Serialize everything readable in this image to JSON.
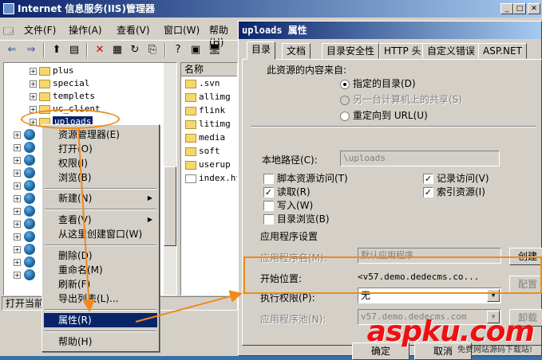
{
  "iis": {
    "title": "Internet 信息服务(IIS)管理器",
    "menu": [
      "文件(F)",
      "操作(A)",
      "查看(V)",
      "窗口(W)",
      "帮助(H)"
    ],
    "status": "打开当前"
  },
  "tree": {
    "folders": [
      "plus",
      "special",
      "templets",
      "uc_client",
      "uploads"
    ]
  },
  "list": {
    "header": "名称",
    "items": [
      ".svn",
      "allimg",
      "flink",
      "litimg",
      "media",
      "soft",
      "userup",
      "index.ht"
    ]
  },
  "context_menu": {
    "items": [
      {
        "label": "资源管理器(E)"
      },
      {
        "label": "打开(O)"
      },
      {
        "label": "权限(I)"
      },
      {
        "label": "浏览(B)"
      },
      {
        "label": "新建(N)"
      },
      {
        "label": "查看(V)"
      },
      {
        "label": "从这里创建窗口(W)"
      },
      {
        "label": "删除(D)"
      },
      {
        "label": "重命名(M)"
      },
      {
        "label": "刷新(F)"
      },
      {
        "label": "导出列表(L)..."
      },
      {
        "label": "属性(R)"
      },
      {
        "label": "帮助(H)"
      }
    ]
  },
  "dialog": {
    "title": "uploads 属性",
    "tabs": [
      "目录",
      "文档",
      "目录安全性",
      "HTTP 头",
      "自定义错误",
      "ASP.NET"
    ],
    "content_from_label": "此资源的内容来自:",
    "radio_options": [
      "指定的目录(D)",
      "另一台计算机上的共享(S)",
      "重定向到 URL(U)"
    ],
    "local_path_label": "本地路径(C):",
    "local_path_value": "\\uploads",
    "checkboxes_left": [
      {
        "label": "脚本资源访问(T)",
        "checked": false
      },
      {
        "label": "读取(R)",
        "checked": true
      },
      {
        "label": "写入(W)",
        "checked": false
      },
      {
        "label": "目录浏览(B)",
        "checked": false
      }
    ],
    "checkboxes_right": [
      {
        "label": "记录访问(V)",
        "checked": true
      },
      {
        "label": "索引资源(I)",
        "checked": true
      }
    ],
    "app_settings_label": "应用程序设置",
    "app_name_label": "应用程序名(M):",
    "app_name_value": "默认应用程序",
    "start_point_label": "开始位置:",
    "start_point_value": "<v57.demo.dedecms.co...",
    "exec_perm_label": "执行权限(P):",
    "exec_perm_value": "无",
    "app_pool_label": "应用程序池(N):",
    "app_pool_value": "v57.demo.dedecms.com",
    "buttons": {
      "create": "创建",
      "config": "配置",
      "unload": "卸载",
      "ok": "确定",
      "cancel": "取消"
    }
  },
  "watermark": {
    "brand": "aspku.com",
    "sub": "免费网站源码下载站!"
  },
  "colors": {
    "accent": "#f08a1c",
    "selection": "#0a246a",
    "window_bg": "#d4d0c8"
  }
}
